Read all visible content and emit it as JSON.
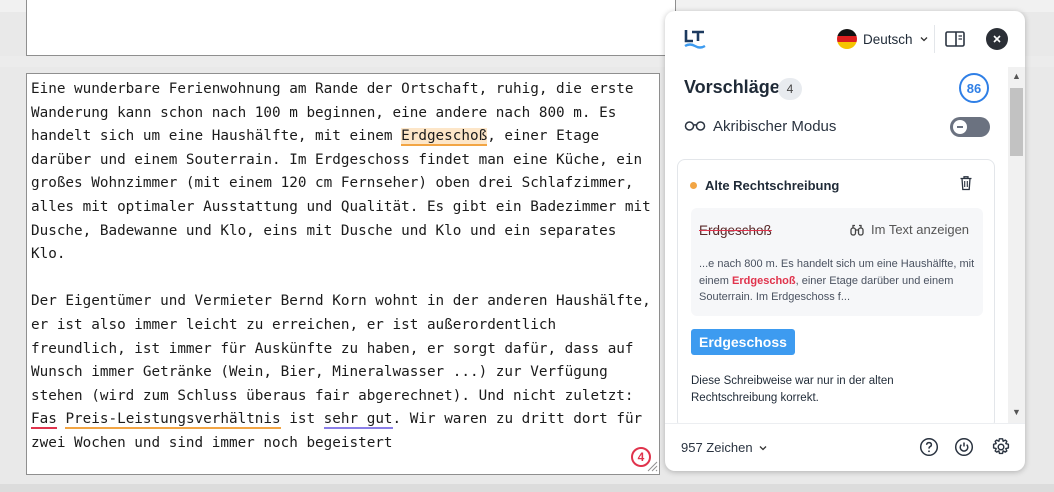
{
  "editor": {
    "p1": {
      "t1": "Eine wunderbare Ferienwohnung am Rande der Ortschaft, ruhig, die erste Wanderung kann schon nach 100 m beginnen, eine andere nach 800 m. Es handelt sich um eine Haushälfte, mit einem ",
      "err": "Erdgeschoß",
      "t2": ", einer Etage darüber und einem Souterrain. Im Erdgeschoss findet man eine Küche, ein großes Wohnzimmer (mit einem 120 cm Fernseher) oben drei Schlafzimmer, alles mit optimaler Ausstattung und Qualität. Es gibt ein Badezimmer mit Dusche, Badewanne und Klo, eins mit Dusche und Klo und ein separates Klo."
    },
    "p2": {
      "t1": "Der Eigentümer und Vermieter Bernd Korn wohnt in der anderen Haushälfte, er ist also immer leicht zu erreichen, er ist außerordentlich freundlich, ist immer für Auskünfte zu haben, er sorgt dafür, dass auf Wunsch immer Getränke (Wein, Bier, Mineralwasser ...) zur Verfügung stehen (wird zum Schluss überaus fair abgerechnet). Und nicht zuletzt: ",
      "err1": "Fas",
      "sp1": " ",
      "err2": "Preis-Leistungsverhältnis",
      "t2": " ist ",
      "err3": "sehr gut",
      "t3": ". Wir waren zu dritt dort für zwei Wochen und sind immer noch begeistert"
    },
    "error_count": "4"
  },
  "panel": {
    "language": "Deutsch",
    "suggestions_title": "Vorschläge",
    "suggestions_count": "4",
    "score": "86",
    "picky_mode_label": "Akribischer Modus",
    "card": {
      "category": "Alte Rechtschreibung",
      "wrong_word": "Erdgeschoß",
      "show_in_text": "Im Text anzeigen",
      "context_before": "...e nach 800 m. Es handelt sich um eine Haushälfte, mit einem ",
      "context_hl": "Erdgeschoß",
      "context_after": ", einer Etage darüber und einem Souterrain. Im Erdgeschoss f...",
      "replacement": "Erdgeschoss",
      "explanation": "Diese Schreibweise war nur in der alten Rechtschreibung korrekt."
    },
    "footer": {
      "char_count": "957 Zeichen"
    }
  },
  "colors": {
    "accent_blue": "#3d9bf0",
    "error_red": "#e0334c",
    "style_orange": "#f2a544",
    "grammar_purple": "#8a7fe8"
  }
}
